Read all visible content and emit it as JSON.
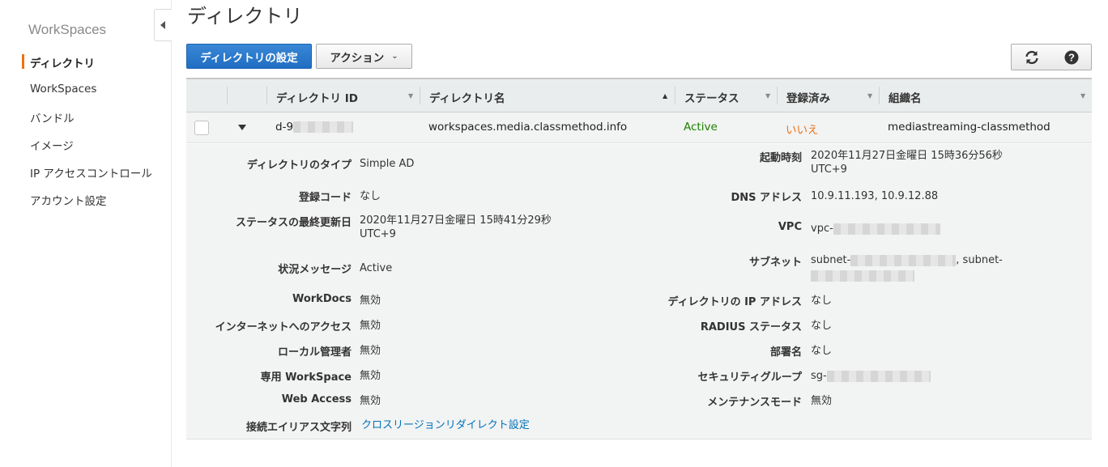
{
  "sidebar": {
    "title": "WorkSpaces",
    "items": [
      {
        "label": "ディレクトリ",
        "active": true
      },
      {
        "label": "WorkSpaces"
      },
      {
        "label": "バンドル"
      },
      {
        "label": "イメージ"
      },
      {
        "label": "IP アクセスコントロール"
      },
      {
        "label": "アカウント設定"
      }
    ]
  },
  "page": {
    "title": "ディレクトリ"
  },
  "toolbar": {
    "primary_label": "ディレクトリの設定",
    "actions_label": "アクション",
    "refresh_icon": "refresh-icon",
    "help_icon": "help-icon"
  },
  "table": {
    "columns": [
      "ディレクトリ ID",
      "ディレクトリ名",
      "ステータス",
      "登録済み",
      "組織名"
    ],
    "row": {
      "id_prefix": "d-9",
      "name": "workspaces.media.classmethod.info",
      "status": "Active",
      "registered": "いいえ",
      "org": "mediastreaming-classmethod"
    }
  },
  "details": {
    "left": [
      {
        "label": "ディレクトリのタイプ",
        "value": "Simple AD"
      },
      {
        "label": "登録コード",
        "value": "なし"
      },
      {
        "label": "ステータスの最終更新日",
        "value": "2020年11月27日金曜日 15時41分29秒",
        "value2": "UTC+9"
      },
      {
        "label": "状況メッセージ",
        "value": "Active"
      },
      {
        "label": "WorkDocs",
        "value": "無効"
      },
      {
        "label": "インターネットへのアクセス",
        "value": "無効"
      },
      {
        "label": "ローカル管理者",
        "value": "無効"
      },
      {
        "label": "専用 WorkSpace",
        "value": "無効"
      },
      {
        "label": "Web Access",
        "value": "無効"
      },
      {
        "label": "接続エイリアス文字列",
        "value": "クロスリージョンリダイレクト設定"
      }
    ],
    "right": [
      {
        "label": "起動時刻",
        "value": "2020年11月27日金曜日 15時36分56秒",
        "value2": "UTC+9"
      },
      {
        "label": "DNS アドレス",
        "value": "10.9.11.193, 10.9.12.88"
      },
      {
        "label": "VPC",
        "value": "vpc-"
      },
      {
        "label": "サブネット",
        "value": "subnet-",
        "value_mid": ", subnet-"
      },
      {
        "label": "ディレクトリの IP アドレス",
        "value": "なし"
      },
      {
        "label": "RADIUS ステータス",
        "value": "なし"
      },
      {
        "label": "部署名",
        "value": "なし"
      },
      {
        "label": "セキュリティグループ",
        "value": "sg-"
      },
      {
        "label": "メンテナンスモード",
        "value": "無効"
      }
    ]
  },
  "colors": {
    "accent": "#ec7211",
    "primary": "#1f6ec3",
    "active": "#1d8102",
    "link": "#0073bb"
  }
}
